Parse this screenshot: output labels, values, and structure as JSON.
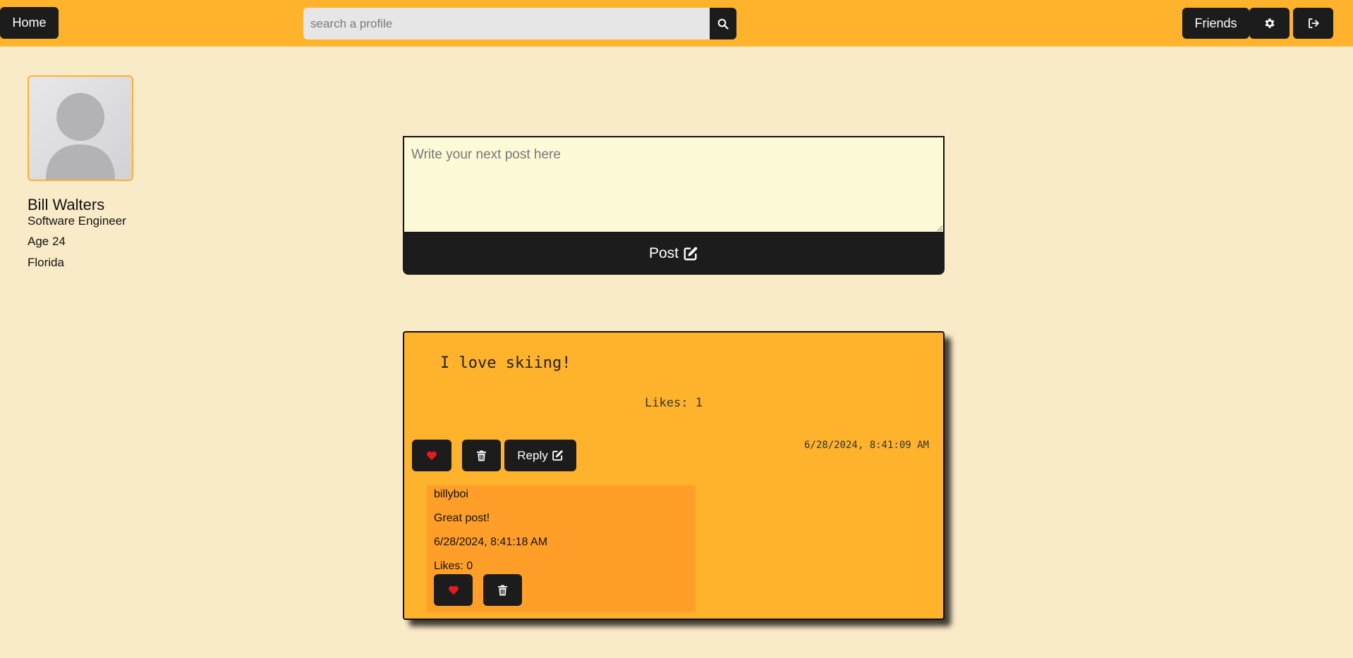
{
  "header": {
    "home_label": "Home",
    "search_placeholder": "search a profile",
    "search_icon": "search-icon",
    "friends_label": "Friends",
    "settings_icon": "gear-icon",
    "logout_icon": "sign-out-icon"
  },
  "profile": {
    "name": "Bill Walters",
    "job": "Software Engineer",
    "age": "Age 24",
    "location": "Florida",
    "avatar_icon": "user-silhouette"
  },
  "composer": {
    "placeholder": "Write your next post here",
    "post_label": "Post",
    "post_icon": "edit-icon"
  },
  "post": {
    "text": "I love skiing!",
    "likes": "Likes: 1",
    "timestamp": "6/28/2024, 8:41:09 AM",
    "reply_label": "Reply",
    "like_icon": "heart-icon",
    "delete_icon": "trash-icon",
    "reply_icon": "edit-icon"
  },
  "reply": {
    "user": "billyboi",
    "text": "Great post!",
    "timestamp": "6/28/2024, 8:41:18 AM",
    "likes": "Likes: 0",
    "like_icon": "heart-icon",
    "delete_icon": "trash-icon"
  },
  "colors": {
    "background": "#faebc8",
    "topbar": "#ffb22c",
    "button": "#1c1c1c",
    "heart": "#e51b1b",
    "post_card": "#ffb22c",
    "reply_box": "#ff9f2a",
    "composer": "#fdfad8"
  }
}
